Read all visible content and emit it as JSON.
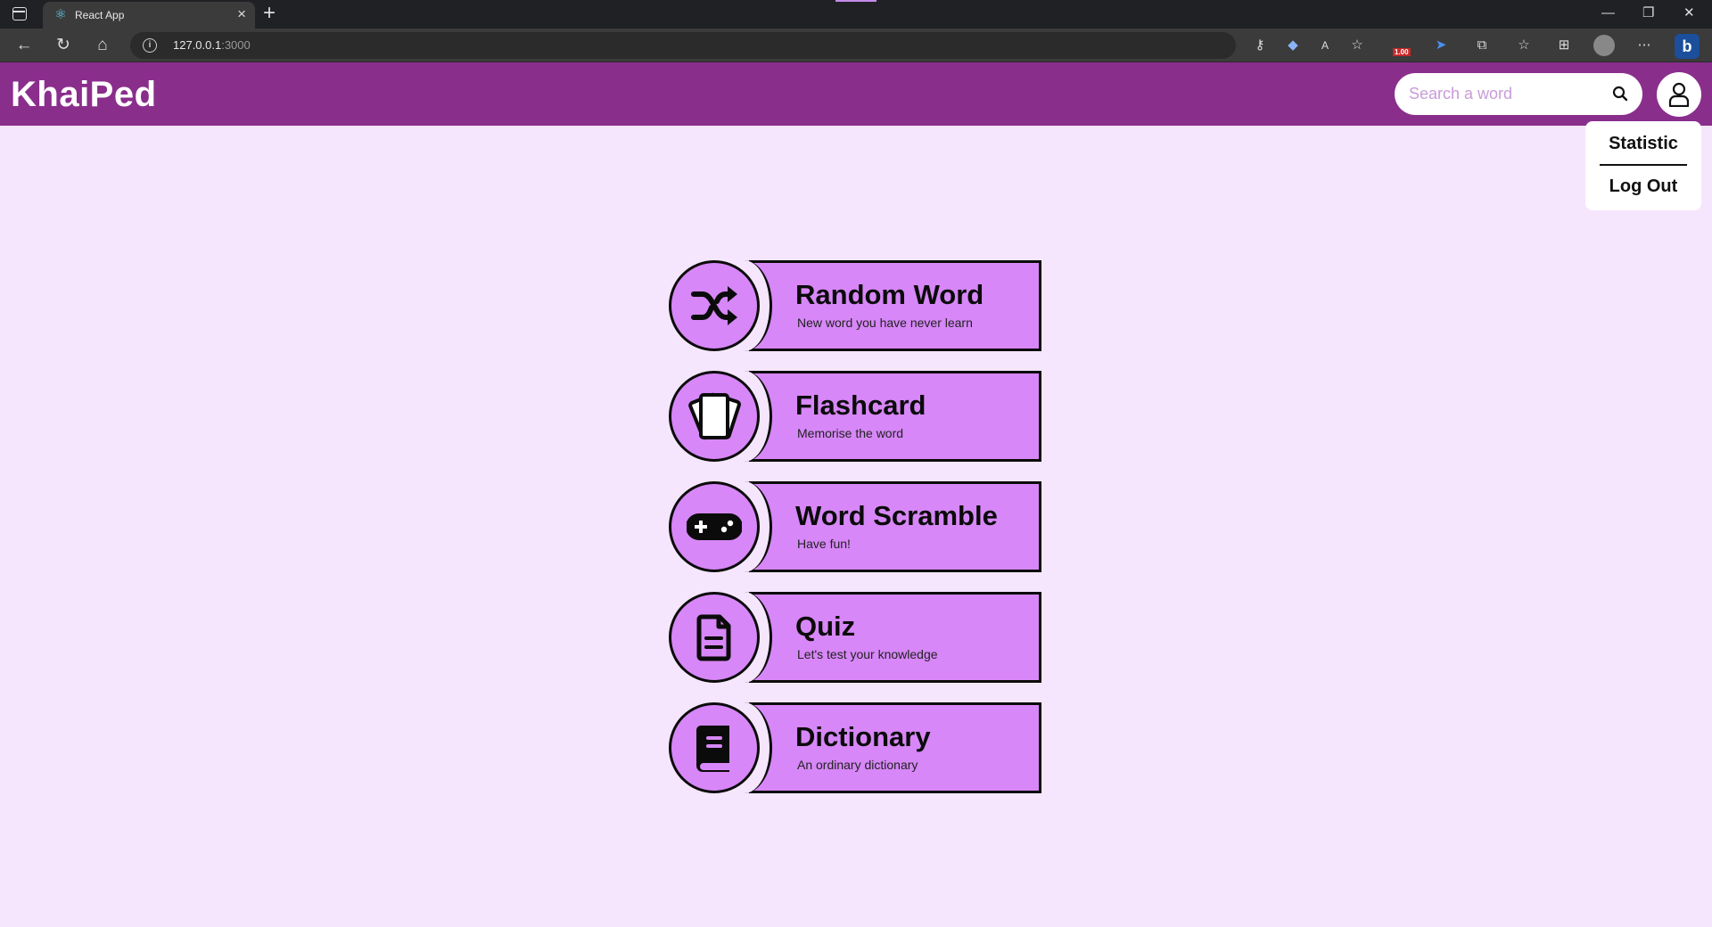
{
  "browser": {
    "tab_title": "React App",
    "url_host": "127.0.0.1",
    "url_port": ":3000",
    "ext_badge": "1.00"
  },
  "header": {
    "logo": "KhaiPed",
    "search_placeholder": "Search a word"
  },
  "dropdown": {
    "items": [
      "Statistic",
      "Log Out"
    ]
  },
  "features": [
    {
      "title": "Random Word",
      "subtitle": "New word you have never learn",
      "icon": "shuffle-icon"
    },
    {
      "title": "Flashcard",
      "subtitle": "Memorise the word",
      "icon": "flashcard-icon"
    },
    {
      "title": "Word Scramble",
      "subtitle": "Have fun!",
      "icon": "gamepad-icon"
    },
    {
      "title": "Quiz",
      "subtitle": "Let's test your knowledge",
      "icon": "document-icon"
    },
    {
      "title": "Dictionary",
      "subtitle": "An ordinary dictionary",
      "icon": "book-icon"
    }
  ],
  "colors": {
    "header": "#8a2e8c",
    "page_bg": "#f5e6fd",
    "card": "#d787f7"
  }
}
